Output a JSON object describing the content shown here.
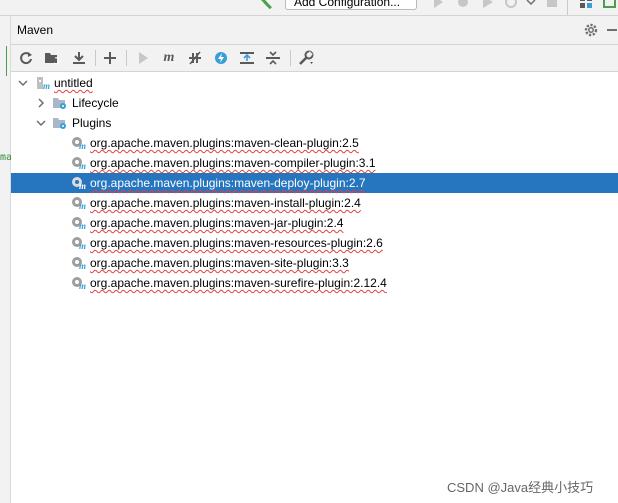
{
  "topbar": {
    "add_configuration_label": "Add Configuration..."
  },
  "header": {
    "title": "Maven"
  },
  "gutter": {
    "mark": "ma"
  },
  "toolbar": {
    "items": [
      "reload-icon",
      "add-folder-icon",
      "download-icon",
      "plus-icon",
      "run-icon",
      "maven-goal-icon",
      "toggle-offline-icon",
      "skip-tests-icon",
      "show-dependencies-icon",
      "collapse-all-icon",
      "settings-wrench-icon"
    ]
  },
  "tree": {
    "root_label": "untitled",
    "lifecycle_label": "Lifecycle",
    "plugins_label": "Plugins",
    "plugins": [
      "org.apache.maven.plugins:maven-clean-plugin:2.5",
      "org.apache.maven.plugins:maven-compiler-plugin:3.1",
      "org.apache.maven.plugins:maven-deploy-plugin:2.7",
      "org.apache.maven.plugins:maven-install-plugin:2.4",
      "org.apache.maven.plugins:maven-jar-plugin:2.4",
      "org.apache.maven.plugins:maven-resources-plugin:2.6",
      "org.apache.maven.plugins:maven-site-plugin:3.3",
      "org.apache.maven.plugins:maven-surefire-plugin:2.12.4"
    ],
    "selected_index": 2
  },
  "watermark": "CSDN @Java经典小技巧",
  "colors": {
    "selection": "#2675bf",
    "accent_blue": "#389fd6",
    "hammer_green": "#4a9f4a"
  }
}
